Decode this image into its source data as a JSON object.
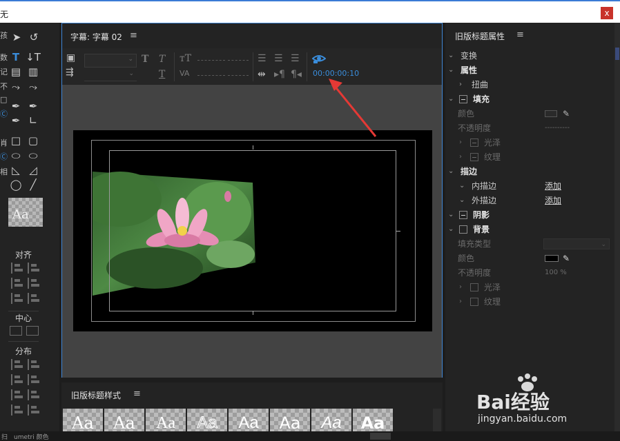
{
  "titlebar": {
    "app_fragment": "无",
    "close_glyph": "x"
  },
  "tools": {
    "edge_glyphs": [
      "视",
      "孩",
      "数",
      "记",
      "不",
      "□",
      "列",
      "Ⓒ",
      "肖",
      "相",
      "Ⓒ",
      "视",
      "Ⓒ",
      "列",
      "Ⓒ",
      "Ⓒ"
    ],
    "preview_text": "Aa",
    "align_label": "对齐",
    "center_label": "中心",
    "distribute_label": "分布"
  },
  "titler": {
    "tab_label": "字幕: 字幕 02",
    "menu_glyph": "≡",
    "timecode": "00:00:00:10",
    "accent_color": "#3a8ddb"
  },
  "properties": {
    "title": "旧版标题属性",
    "menu_glyph": "≡",
    "rows": [
      {
        "label": "变换",
        "style": "norm",
        "chev": "⌄"
      },
      {
        "label": "属性",
        "style": "bold",
        "chev": "⌄"
      },
      {
        "label": "扭曲",
        "style": "norm",
        "chev": "›"
      },
      {
        "label": "填充",
        "style": "bold",
        "chev": "⌄"
      },
      {
        "label": "颜色",
        "style": "dim"
      },
      {
        "label": "不透明度",
        "style": "dim",
        "value": "----------"
      },
      {
        "label": "光泽",
        "style": "dim",
        "chev": "›"
      },
      {
        "label": "纹理",
        "style": "dim",
        "chev": "›"
      },
      {
        "label": "描边",
        "style": "bold",
        "chev": "⌄"
      },
      {
        "label": "内描边",
        "style": "norm",
        "chev": "⌄",
        "link": "添加"
      },
      {
        "label": "外描边",
        "style": "norm",
        "chev": "⌄",
        "link": "添加"
      },
      {
        "label": "阴影",
        "style": "bold",
        "chev": "⌄"
      },
      {
        "label": "背景",
        "style": "bold",
        "chev": "⌄"
      },
      {
        "label": "填充类型",
        "style": "dim"
      },
      {
        "label": "颜色",
        "style": "dim"
      },
      {
        "label": "不透明度",
        "style": "dim",
        "value": "100 %"
      },
      {
        "label": "光泽",
        "style": "dim",
        "chev": "›"
      },
      {
        "label": "纹理",
        "style": "dim",
        "chev": "›"
      }
    ]
  },
  "styles": {
    "title": "旧版标题样式",
    "menu_glyph": "≡",
    "tiles": [
      "Aa",
      "Aa",
      "Aa",
      "Aa",
      "Aa",
      "Aa",
      "Aa",
      "Aa"
    ]
  },
  "bottom": {
    "left_text": "扫",
    "text2": "umetri 颜色"
  },
  "watermark": {
    "brand": "Bai经验",
    "url": "jingyan.baidu.com"
  }
}
